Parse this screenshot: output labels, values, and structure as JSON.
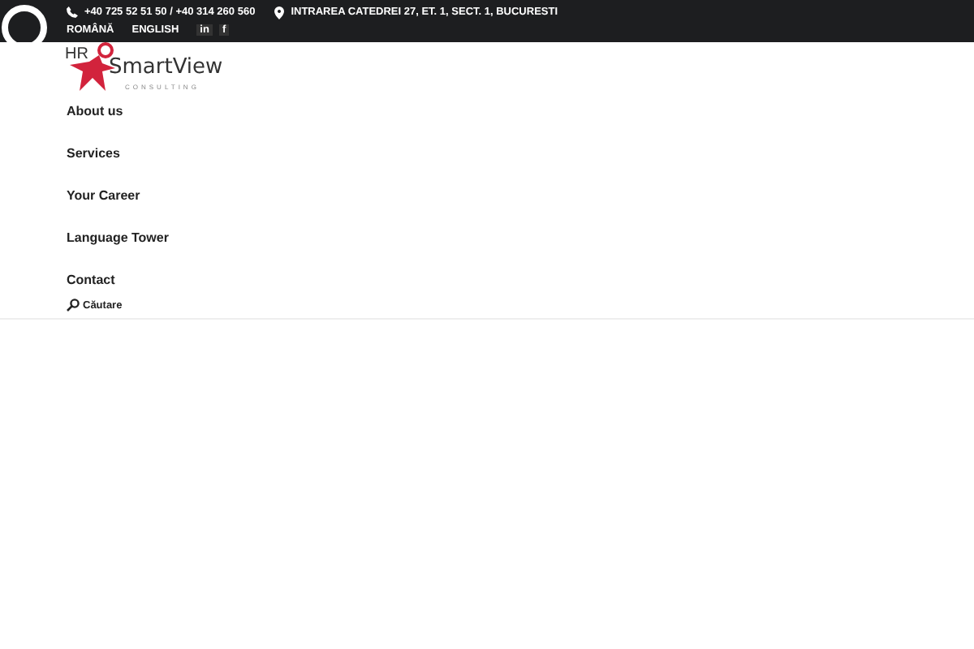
{
  "top_bar": {
    "phone": "+40 725 52 51 50 / +40 314 260 560",
    "address": "INTRAREA CATEDREI 27, ET. 1, SECT. 1, BUCURESTI",
    "languages": [
      "ROMÂNĂ",
      "ENGLISH"
    ],
    "social": [
      "in",
      "f"
    ]
  },
  "logo": {
    "initials": "HR",
    "name": "SmartView",
    "tagline": "CONSULTING"
  },
  "nav": [
    "About us",
    "Services",
    "Your Career",
    "Language Tower",
    "Contact"
  ],
  "search": {
    "label": "Căutare"
  }
}
